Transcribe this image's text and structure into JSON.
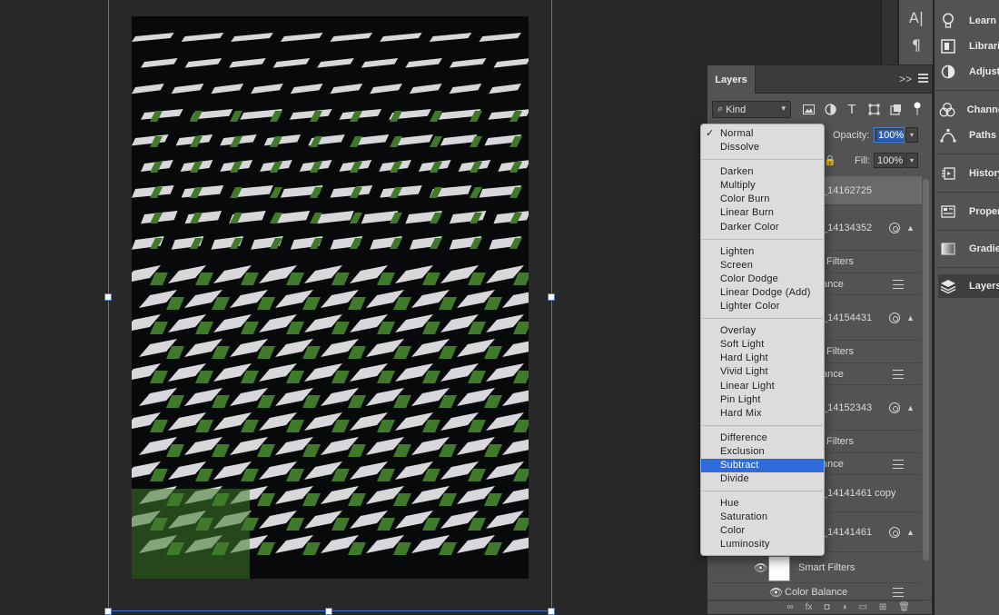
{
  "document": {
    "photo_description_colors": {
      "dark": "#07090a",
      "stripe": "#d8d8dc",
      "green": "#3f7a2a"
    }
  },
  "mini_tools": {
    "char_icon": "A|",
    "para_icon": "¶"
  },
  "dock": {
    "items": [
      {
        "label": "Learn",
        "icon": "lightbulb-icon"
      },
      {
        "label": "Librari",
        "icon": "libraries-icon"
      },
      {
        "label": "Adjust",
        "icon": "adjustments-icon"
      },
      {
        "label": "Channe",
        "icon": "channels-icon"
      },
      {
        "label": "Paths",
        "icon": "paths-icon"
      },
      {
        "label": "History",
        "icon": "history-icon"
      },
      {
        "label": "Proper",
        "icon": "properties-icon"
      },
      {
        "label": "Gradie",
        "icon": "gradients-icon"
      },
      {
        "label": "Layers",
        "icon": "layers-icon"
      }
    ]
  },
  "layers_panel": {
    "tab_label": "Layers",
    "kind_label": "Kind",
    "opacity_label": "Opacity:",
    "opacity_value": "100%",
    "fill_label": "Fill:",
    "fill_value": "100%",
    "rows": [
      {
        "text": "_14162725"
      },
      {
        "text": "_14134352"
      },
      {
        "text": "Filters"
      },
      {
        "text": "ance"
      },
      {
        "text": "_14154431"
      },
      {
        "text": "Filters"
      },
      {
        "text": "ance"
      },
      {
        "text": "_14152343"
      },
      {
        "text": "Filters"
      },
      {
        "text": "ance"
      },
      {
        "text": "_14141461 copy"
      },
      {
        "text": "_14141461"
      },
      {
        "text": "Smart Filters"
      },
      {
        "text": "Color Balance"
      }
    ],
    "bottom_icons": [
      "link-icon",
      "fx-icon",
      "mask-icon",
      "adjustment-icon",
      "folder-icon",
      "new-layer-icon",
      "trash-icon"
    ],
    "bottom_labels": [
      "∞",
      "fx",
      "◘",
      "◑",
      "▭",
      "⊞",
      "🗑"
    ]
  },
  "blend_menu": {
    "groups": [
      [
        "Normal",
        "Dissolve"
      ],
      [
        "Darken",
        "Multiply",
        "Color Burn",
        "Linear Burn",
        "Darker Color"
      ],
      [
        "Lighten",
        "Screen",
        "Color Dodge",
        "Linear Dodge (Add)",
        "Lighter Color"
      ],
      [
        "Overlay",
        "Soft Light",
        "Hard Light",
        "Vivid Light",
        "Linear Light",
        "Pin Light",
        "Hard Mix"
      ],
      [
        "Difference",
        "Exclusion",
        "Subtract",
        "Divide"
      ],
      [
        "Hue",
        "Saturation",
        "Color",
        "Luminosity"
      ]
    ],
    "checked": "Normal",
    "highlighted": "Subtract"
  }
}
